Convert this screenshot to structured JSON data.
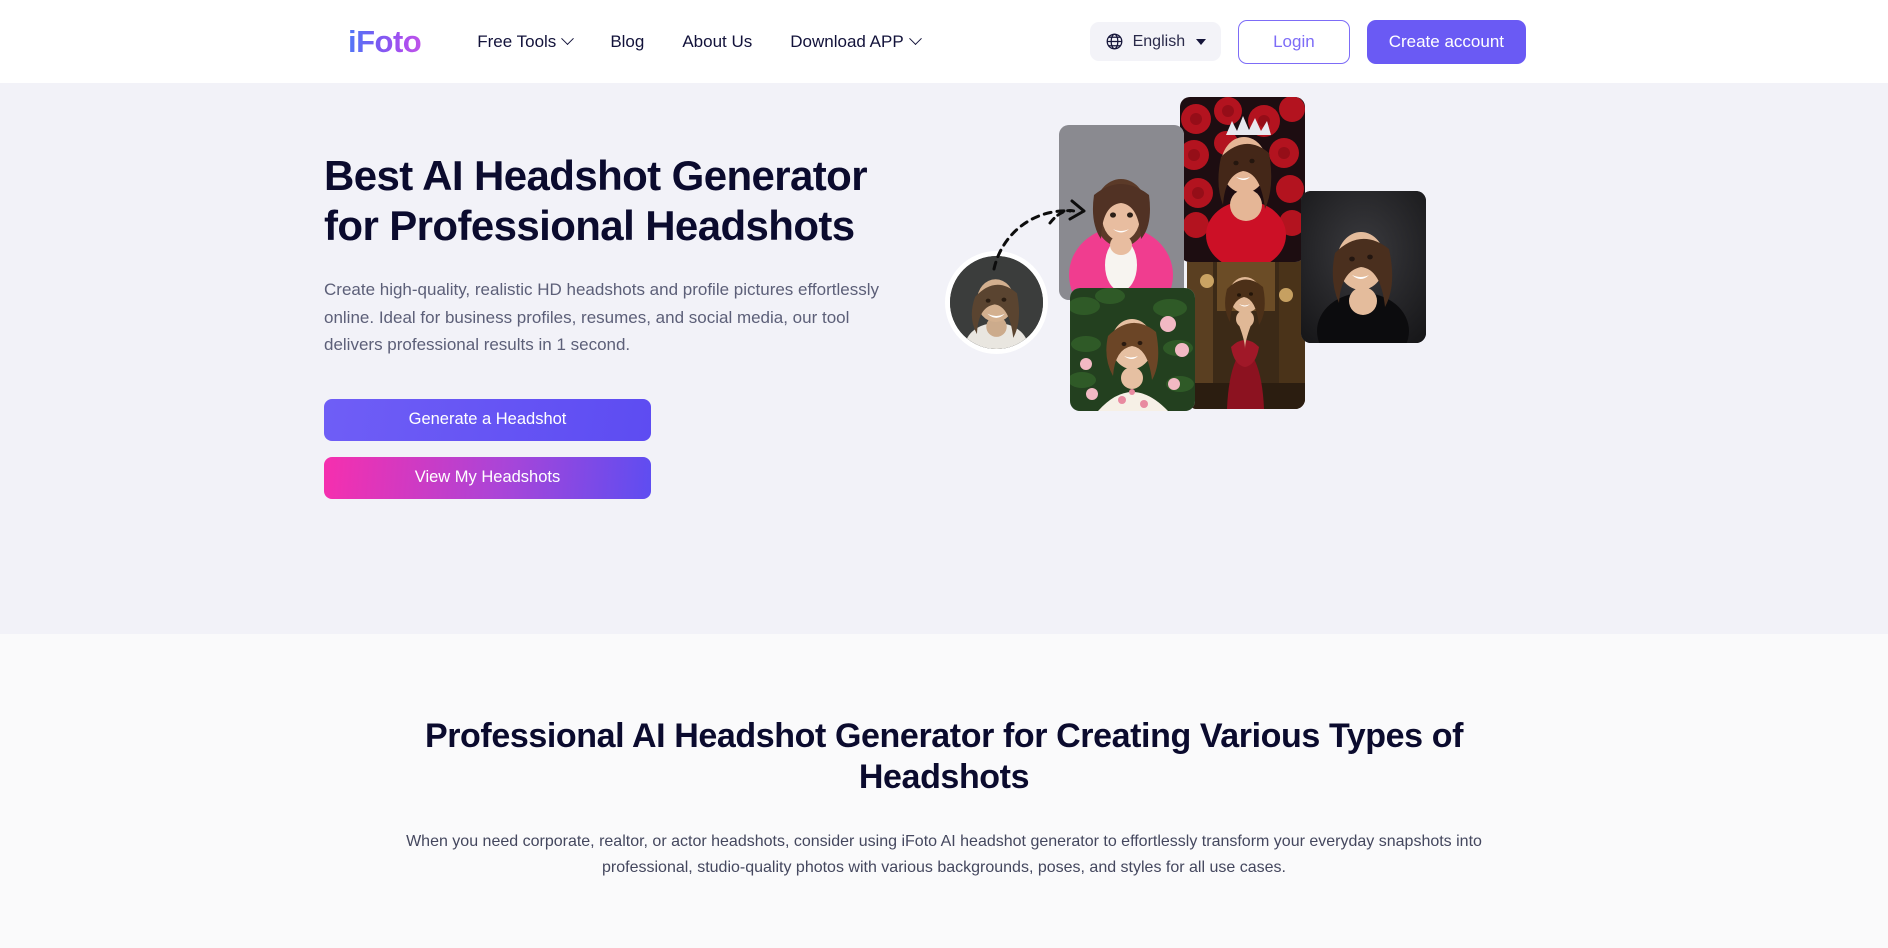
{
  "header": {
    "logo": "iFoto",
    "nav": [
      {
        "label": "Free Tools",
        "has_dropdown": true
      },
      {
        "label": "Blog",
        "has_dropdown": false
      },
      {
        "label": "About Us",
        "has_dropdown": false
      },
      {
        "label": "Download APP",
        "has_dropdown": true
      }
    ],
    "language": {
      "label": "English",
      "icon": "globe-icon"
    },
    "login_label": "Login",
    "create_account_label": "Create account"
  },
  "hero": {
    "title_line1": "Best AI Headshot Generator",
    "title_line2": "for Professional Headshots",
    "description": "Create high-quality, realistic HD headshots and profile pictures effortlessly online. Ideal for business profiles, resumes, and social media, our tool delivers professional results in 1 second.",
    "primary_cta": "Generate a Headshot",
    "secondary_cta": "View My Headshots",
    "collage": {
      "source_photo_alt": "smiling-woman-selfie-source-photo",
      "results": [
        {
          "alt": "woman-in-pink-blazer-studio-headshot"
        },
        {
          "alt": "woman-with-tiara-red-roses-backdrop"
        },
        {
          "alt": "woman-in-black-turtleneck-dark-background"
        },
        {
          "alt": "woman-in-floral-dress-garden-background"
        },
        {
          "alt": "woman-in-red-gown-hotel-interior"
        }
      ]
    }
  },
  "section2": {
    "title": "Professional AI Headshot Generator for Creating Various Types of Headshots",
    "paragraph": "When you need corporate, realtor, or actor headshots, consider using iFoto AI headshot generator to effortlessly transform your everyday snapshots into professional, studio-quality photos with various backgrounds, poses, and styles for all use cases."
  },
  "colors": {
    "brand_purple": "#6a5af4",
    "brand_pink": "#f62fae",
    "hero_bg": "#f2f2f8",
    "section_bg": "#fafafb",
    "heading": "#0b0b2e",
    "body_text": "#5c5f78"
  }
}
